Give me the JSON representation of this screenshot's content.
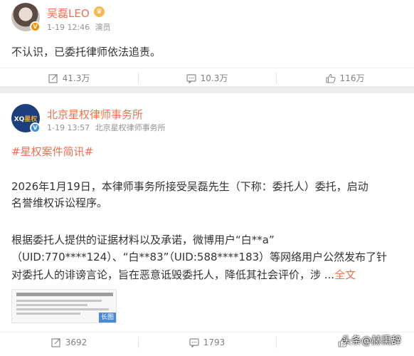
{
  "post1": {
    "author": "吴磊LEO",
    "meta_date": "1-19 12:46",
    "meta_source": "演员",
    "text": "不认识，已委托律师依法追责。",
    "reposts": "41.3万",
    "comments": "10.3万",
    "likes": "116万"
  },
  "post2": {
    "author": "北京星权律师事务所",
    "avatar_logo": "XQ",
    "avatar_logo_accent": "星权",
    "meta_date": "1-19 13:57",
    "meta_source": "北京星权律师事务所",
    "hashtag": "#星权案件简讯#",
    "paragraph1_line1": "2026年1月19日，本律师事务所接受吴磊先生（下称：委托人）委托，启动",
    "paragraph1_line2": "名誉维权诉讼程序。",
    "paragraph2_line1": "根据委托人提供的证据材料以及承诺，微博用户“白**a”",
    "paragraph2_line2": "（UID:770****124）、“白**83”（UID:588****183）等网络用户公然发布了针",
    "paragraph2_line3": "对委托人的诽谤言论，旨在恶意诋毁委托人，降低其社会评价，涉 ...",
    "full_text_link": "全文",
    "thumbnail_badge": "长图",
    "reposts": "3692",
    "comments": "1793"
  },
  "watermark": "头条@赫熏辞",
  "colors": {
    "accent": "#eb7350",
    "text": "#333333",
    "meta": "#939393"
  }
}
